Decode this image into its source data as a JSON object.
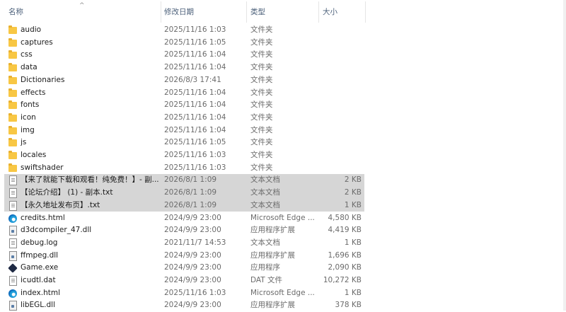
{
  "header": {
    "name": "名称",
    "date": "修改日期",
    "type": "类型",
    "size": "大小",
    "sort_arrow": "^"
  },
  "files": [
    {
      "icon": "folder-icon",
      "name": "audio",
      "date": "2025/11/16 1:03",
      "type": "文件夹",
      "size": ""
    },
    {
      "icon": "folder-icon",
      "name": "captures",
      "date": "2025/11/16 1:05",
      "type": "文件夹",
      "size": ""
    },
    {
      "icon": "folder-icon",
      "name": "css",
      "date": "2025/11/16 1:04",
      "type": "文件夹",
      "size": ""
    },
    {
      "icon": "folder-icon",
      "name": "data",
      "date": "2025/11/16 1:04",
      "type": "文件夹",
      "size": ""
    },
    {
      "icon": "folder-icon",
      "name": "Dictionaries",
      "date": "2026/8/3 17:41",
      "type": "文件夹",
      "size": ""
    },
    {
      "icon": "folder-icon",
      "name": "effects",
      "date": "2025/11/16 1:04",
      "type": "文件夹",
      "size": ""
    },
    {
      "icon": "folder-icon",
      "name": "fonts",
      "date": "2025/11/16 1:04",
      "type": "文件夹",
      "size": ""
    },
    {
      "icon": "folder-icon",
      "name": "icon",
      "date": "2025/11/16 1:04",
      "type": "文件夹",
      "size": ""
    },
    {
      "icon": "folder-icon",
      "name": "img",
      "date": "2025/11/16 1:04",
      "type": "文件夹",
      "size": ""
    },
    {
      "icon": "folder-icon",
      "name": "js",
      "date": "2025/11/16 1:05",
      "type": "文件夹",
      "size": ""
    },
    {
      "icon": "folder-icon",
      "name": "locales",
      "date": "2025/11/16 1:03",
      "type": "文件夹",
      "size": ""
    },
    {
      "icon": "folder-icon",
      "name": "swiftshader",
      "date": "2025/11/16 1:03",
      "type": "文件夹",
      "size": ""
    },
    {
      "icon": "text-document-icon",
      "name": "【来了就能下载和观看！纯免费！】- 副...",
      "date": "2026/8/1 1:09",
      "type": "文本文档",
      "size": "2 KB",
      "selected": true
    },
    {
      "icon": "text-document-icon",
      "name": "【论坛介绍】 (1) - 副本.txt",
      "date": "2026/8/1 1:09",
      "type": "文本文档",
      "size": "2 KB",
      "selected": true
    },
    {
      "icon": "text-document-icon",
      "name": "【永久地址发布页】.txt",
      "date": "2026/8/1 1:09",
      "type": "文本文档",
      "size": "1 KB",
      "selected": true
    },
    {
      "icon": "edge-html-icon",
      "name": "credits.html",
      "date": "2024/9/9 23:00",
      "type": "Microsoft Edge ...",
      "size": "4,580 KB"
    },
    {
      "icon": "dll-file-icon",
      "name": "d3dcompiler_47.dll",
      "date": "2024/9/9 23:00",
      "type": "应用程序扩展",
      "size": "4,419 KB"
    },
    {
      "icon": "text-document-icon",
      "name": "debug.log",
      "date": "2021/11/7 14:53",
      "type": "文本文档",
      "size": "1 KB"
    },
    {
      "icon": "dll-file-icon",
      "name": "ffmpeg.dll",
      "date": "2024/9/9 23:00",
      "type": "应用程序扩展",
      "size": "1,696 KB"
    },
    {
      "icon": "exe-app-icon",
      "name": "Game.exe",
      "date": "2024/9/9 23:00",
      "type": "应用程序",
      "size": "2,090 KB"
    },
    {
      "icon": "text-document-icon",
      "name": "icudtl.dat",
      "date": "2024/9/9 23:00",
      "type": "DAT 文件",
      "size": "10,272 KB"
    },
    {
      "icon": "edge-html-icon",
      "name": "index.html",
      "date": "2025/11/16 1:03",
      "type": "Microsoft Edge ...",
      "size": "1 KB"
    },
    {
      "icon": "dll-file-icon",
      "name": "libEGL.dll",
      "date": "2024/9/9 23:00",
      "type": "应用程序扩展",
      "size": "378 KB"
    }
  ]
}
